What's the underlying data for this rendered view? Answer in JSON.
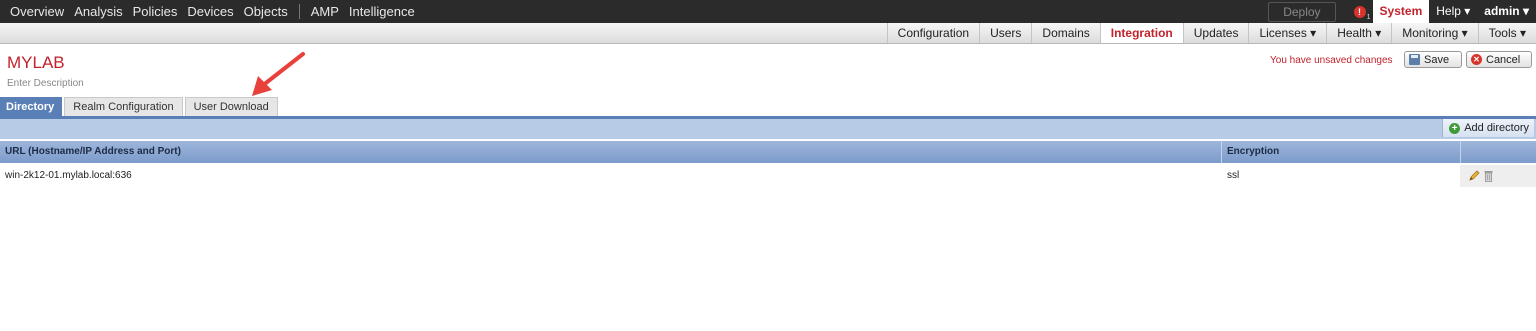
{
  "topnav": {
    "items": [
      "Overview",
      "Analysis",
      "Policies",
      "Devices",
      "Objects",
      "AMP",
      "Intelligence"
    ],
    "deploy": "Deploy",
    "alert_count": "1",
    "system": "System",
    "help": "Help ▾",
    "user": "admin ▾"
  },
  "subnav": {
    "tabs": [
      "Configuration",
      "Users",
      "Domains",
      "Integration",
      "Updates",
      "Licenses ▾",
      "Health ▾",
      "Monitoring ▾",
      "Tools ▾"
    ],
    "active": "Integration"
  },
  "header": {
    "title": "MYLAB",
    "description_placeholder": "Enter Description",
    "unsaved": "You have unsaved changes",
    "save": "Save",
    "cancel": "Cancel"
  },
  "page_tabs": [
    "Directory",
    "Realm Configuration",
    "User Download"
  ],
  "toolbar": {
    "add_directory": "Add directory"
  },
  "table": {
    "columns": [
      "URL (Hostname/IP Address and Port)",
      "Encryption"
    ],
    "rows": [
      {
        "url": "win-2k12-01.mylab.local:636",
        "encryption": "ssl"
      }
    ]
  },
  "colors": {
    "brand_red": "#c1232b",
    "tab_blue": "#5a7fb6",
    "nav_dark": "#2b2b2b",
    "annotation_arrow": "#e8403a"
  }
}
